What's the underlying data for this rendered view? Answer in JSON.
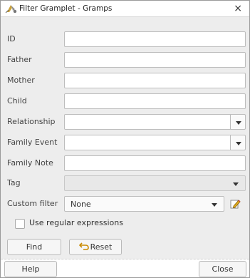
{
  "window": {
    "title": "Filter Gramplet - Gramps",
    "close_glyph": "×",
    "icon": "gramps-app-icon"
  },
  "fields": [
    {
      "label": "ID",
      "type": "text",
      "value": ""
    },
    {
      "label": "Father",
      "type": "text",
      "value": ""
    },
    {
      "label": "Mother",
      "type": "text",
      "value": ""
    },
    {
      "label": "Child",
      "type": "text",
      "value": ""
    },
    {
      "label": "Relationship",
      "type": "combo-entry",
      "value": ""
    },
    {
      "label": "Family Event",
      "type": "combo-entry",
      "value": ""
    },
    {
      "label": "Family Note",
      "type": "text",
      "value": ""
    },
    {
      "label": "Tag",
      "type": "combo",
      "value": ""
    }
  ],
  "custom_filter": {
    "label": "Custom filter",
    "value": "None",
    "edit_icon": "edit-pencil-icon"
  },
  "regex": {
    "label": "Use regular expressions",
    "checked": false
  },
  "buttons": {
    "find": "Find",
    "reset": "Reset",
    "reset_icon": "undo-arrow-icon"
  },
  "footer": {
    "help": "Help",
    "close": "Close"
  },
  "colors": {
    "background": "#ededed",
    "border": "#bdbdbd",
    "accent": "#e0b020"
  }
}
